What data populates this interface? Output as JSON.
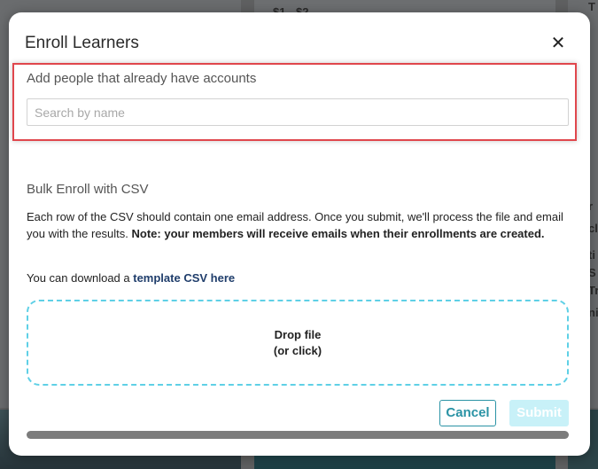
{
  "background": {
    "price_text": "$1 - $2",
    "edge_letters": [
      "T",
      "r",
      "cl",
      "ti",
      "S",
      "Tr",
      "ni"
    ]
  },
  "modal": {
    "title": "Enroll Learners",
    "close_icon": "close-icon",
    "existing": {
      "label": "Add people that already have accounts",
      "search_placeholder": "Search by name",
      "search_value": ""
    },
    "bulk": {
      "title": "Bulk Enroll with CSV",
      "description": "Each row of the CSV should contain one email address. Once you submit, we'll process the file and email you with the results.",
      "note": "Note: your members will receive emails when their enrollments are created.",
      "download_prefix": "You can download a",
      "download_link": "template CSV here"
    },
    "dropzone": {
      "line1": "Drop file",
      "line2": "(or click)"
    },
    "buttons": {
      "cancel": "Cancel",
      "submit": "Submit"
    }
  },
  "colors": {
    "accent": "#2a93a5",
    "dropzone_border": "#5fd0e6",
    "highlight": "#e0474d",
    "submit_disabled_bg": "#c8f1f8",
    "link": "#1f3d6b"
  }
}
